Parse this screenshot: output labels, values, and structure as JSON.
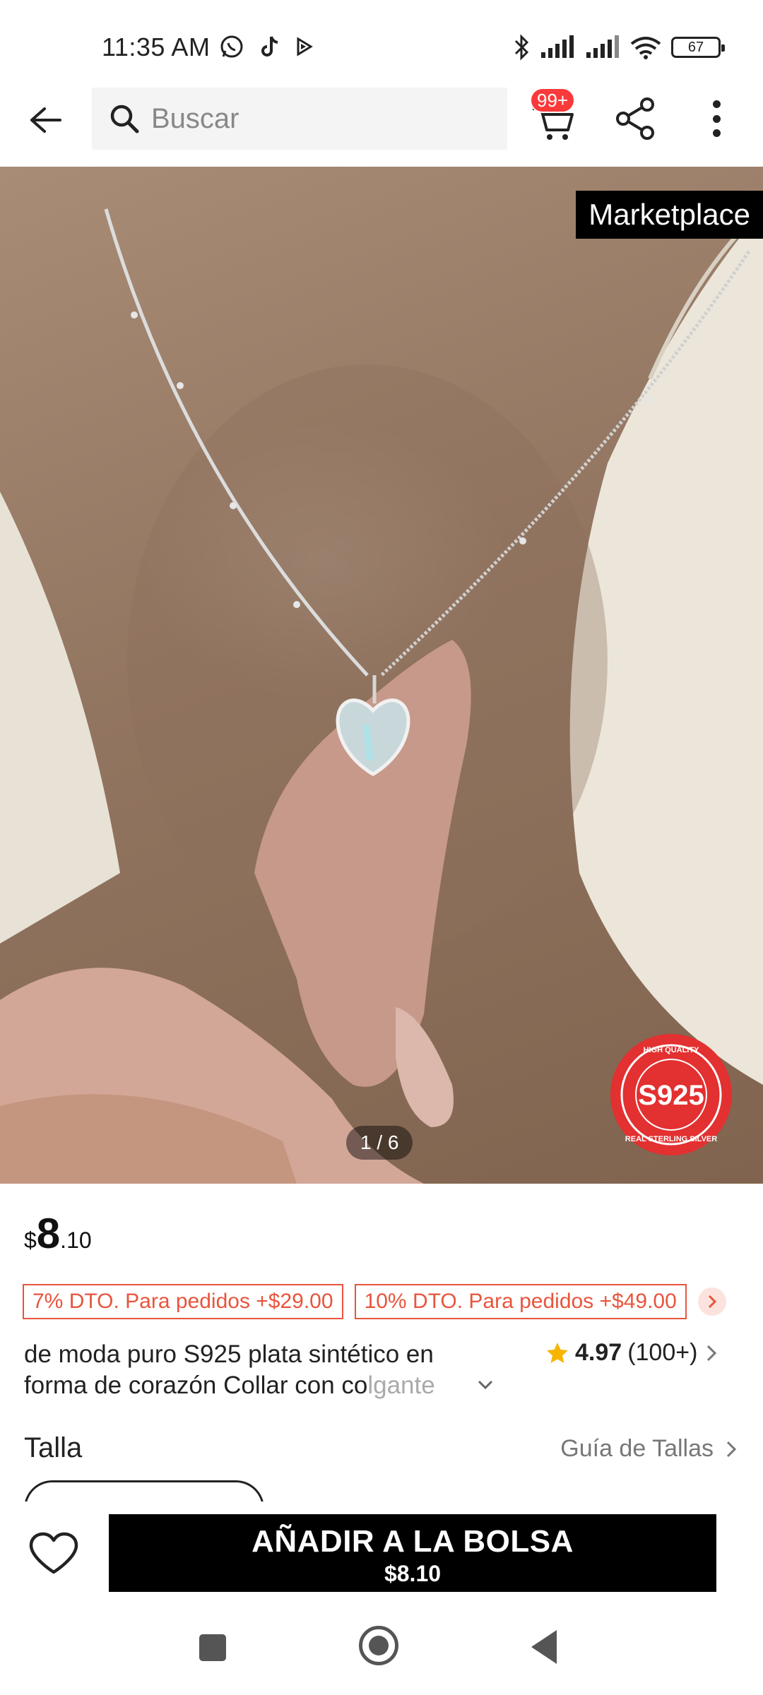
{
  "status_bar": {
    "time": "11:35 AM",
    "battery": "67",
    "left_icons": [
      "whatsapp-icon",
      "tiktok-icon",
      "play-icon"
    ],
    "right_icons": [
      "bluetooth-icon",
      "signal-icon",
      "signal-icon",
      "wifi-icon",
      "battery-icon"
    ]
  },
  "header": {
    "search_placeholder": "Buscar",
    "cart_badge": "99+"
  },
  "gallery": {
    "marketplace_label": "Marketplace",
    "counter": "1 / 6",
    "badge_text": "S925",
    "badge_top_text": "HIGH QUALITY",
    "badge_bottom_text": "REAL STERLING SILVER"
  },
  "product": {
    "price_symbol": "$",
    "price_int": "8",
    "price_dec": ".10",
    "coupons": [
      "7% DTO. Para pedidos +$29.00",
      "10% DTO. Para pedidos +$49.00"
    ],
    "title_line1": "de moda puro S925 plata sintético en",
    "title_line2": "forma de corazón Collar con colgante",
    "rating_score": "4.97",
    "rating_count": "(100+)"
  },
  "size": {
    "label": "Talla",
    "guide": "Guía de Tallas"
  },
  "action_bar": {
    "add_label": "AÑADIR A LA BOLSA",
    "add_price": "$8.10"
  },
  "colors": {
    "accent_red": "#e8553d",
    "badge_red": "#fa3a3a",
    "cta_black": "#000000",
    "star": "#f7b500"
  }
}
